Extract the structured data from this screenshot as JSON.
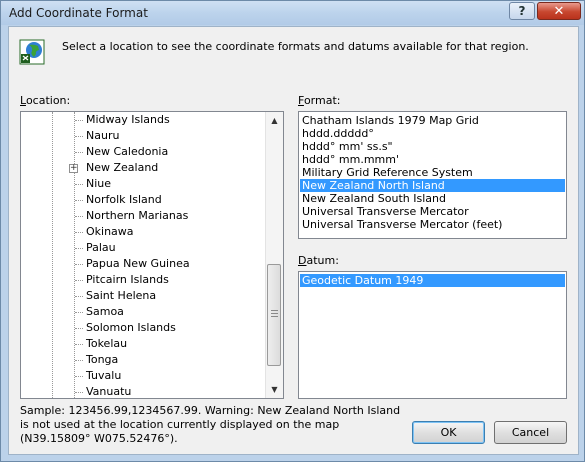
{
  "window": {
    "title": "Add Coordinate Format",
    "help_glyph": "?",
    "close_glyph": "✕"
  },
  "intro": "Select a location to see the coordinate formats and datums available for that region.",
  "location": {
    "label": "Location:",
    "items": [
      {
        "label": "Midway Islands"
      },
      {
        "label": "Nauru"
      },
      {
        "label": "New Caledonia"
      },
      {
        "label": "New Zealand",
        "expandable": true,
        "expander_glyph": "+"
      },
      {
        "label": "Niue"
      },
      {
        "label": "Norfolk Island"
      },
      {
        "label": "Northern Marianas"
      },
      {
        "label": "Okinawa"
      },
      {
        "label": "Palau"
      },
      {
        "label": "Papua New Guinea"
      },
      {
        "label": "Pitcairn Islands"
      },
      {
        "label": "Saint Helena"
      },
      {
        "label": "Samoa"
      },
      {
        "label": "Solomon Islands"
      },
      {
        "label": "Tokelau"
      },
      {
        "label": "Tonga"
      },
      {
        "label": "Tuvalu"
      },
      {
        "label": "Vanuatu"
      }
    ],
    "scroll_up_glyph": "▲",
    "scroll_down_glyph": "▼"
  },
  "format": {
    "label": "Format:",
    "items": [
      "Chatham Islands 1979 Map Grid",
      "hddd.ddddd°",
      "hddd° mm' ss.s\"",
      "hddd° mm.mmm'",
      "Military Grid Reference System",
      "New Zealand North Island",
      "New Zealand South Island",
      "Universal Transverse Mercator",
      "Universal Transverse Mercator (feet)"
    ],
    "selected_index": 5
  },
  "datum": {
    "label": "Datum:",
    "items": [
      "Geodetic Datum 1949"
    ],
    "selected_index": 0
  },
  "sample_text": "Sample: 123456.99,1234567.99.  Warning: New Zealand North Island  is not used at the location currently displayed on the map (N39.15809° W075.52476°).",
  "buttons": {
    "ok": "OK",
    "cancel": "Cancel"
  },
  "colors": {
    "selection": "#3399ff",
    "title_bar": "#bcd3ec",
    "close_button": "#c7472f"
  }
}
